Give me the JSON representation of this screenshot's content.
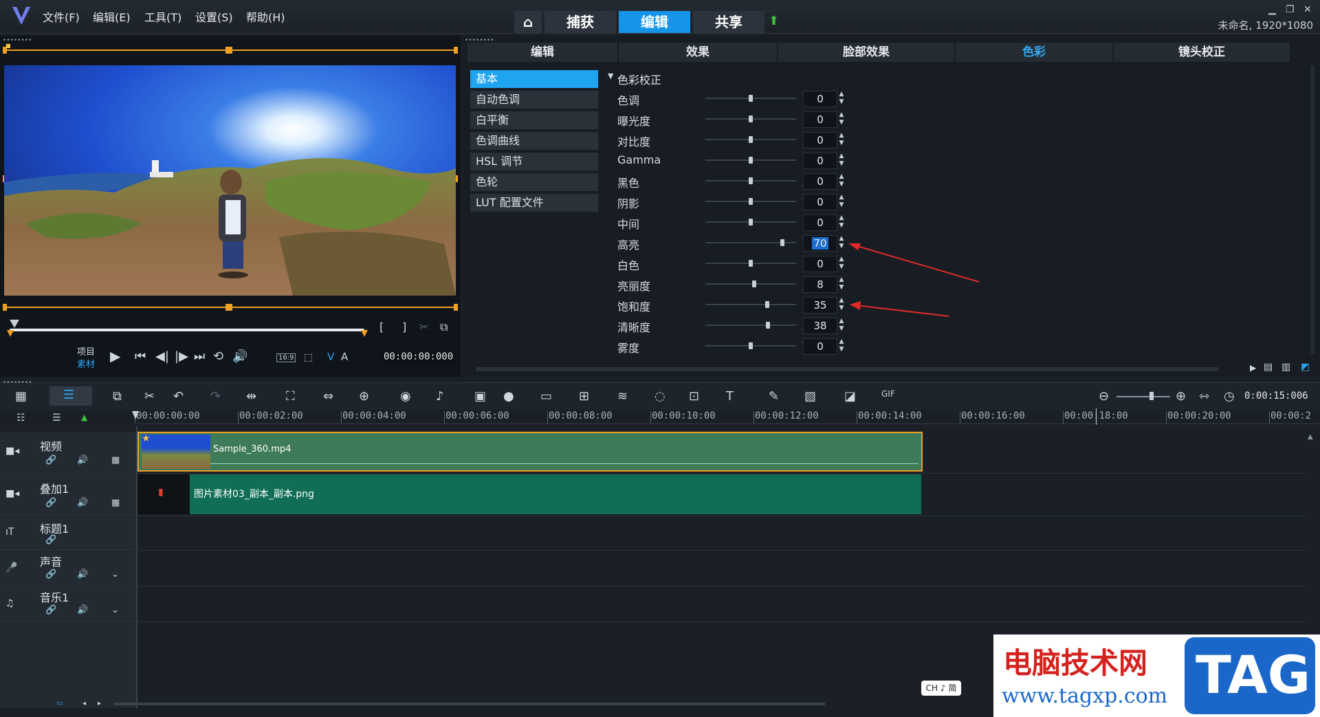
{
  "menu": [
    "文件(F)",
    "编辑(E)",
    "工具(T)",
    "设置(S)",
    "帮助(H)"
  ],
  "main_tabs": [
    "捕获",
    "编辑",
    "共享"
  ],
  "project_title": "未命名, 1920*1080",
  "preview": {
    "mode_project": "项目",
    "mode_clip": "素材",
    "aspect": "16:9",
    "timecode": "00:00:00:000",
    "v_label": "V",
    "a_label": "A"
  },
  "sub_tabs": [
    "编辑",
    "效果",
    "脸部效果",
    "色彩",
    "镜头校正"
  ],
  "categories": [
    "基本",
    "自动色调",
    "白平衡",
    "色调曲线",
    "HSL 调节",
    "色轮",
    "LUT 配置文件"
  ],
  "section_title": "色彩校正",
  "adjustments": [
    {
      "label": "色调",
      "value": "0",
      "pos": 0.5
    },
    {
      "label": "曝光度",
      "value": "0",
      "pos": 0.5
    },
    {
      "label": "对比度",
      "value": "0",
      "pos": 0.5
    },
    {
      "label": "Gamma",
      "value": "0",
      "pos": 0.5
    },
    {
      "label": "黑色",
      "value": "0",
      "pos": 0.5
    },
    {
      "label": "阴影",
      "value": "0",
      "pos": 0.5
    },
    {
      "label": "中间",
      "value": "0",
      "pos": 0.5
    },
    {
      "label": "高亮",
      "value": "70",
      "pos": 0.85
    },
    {
      "label": "白色",
      "value": "0",
      "pos": 0.5
    },
    {
      "label": "亮丽度",
      "value": "8",
      "pos": 0.54
    },
    {
      "label": "饱和度",
      "value": "35",
      "pos": 0.68
    },
    {
      "label": "清晰度",
      "value": "38",
      "pos": 0.69
    },
    {
      "label": "雾度",
      "value": "0",
      "pos": 0.5
    }
  ],
  "timeline": {
    "zoom_time": "0:00:15:006",
    "ruler": [
      "00:00:00:00",
      "00:00:02:00",
      "00:00:04:00",
      "00:00:06:00",
      "00:00:08:00",
      "00:00:10:00",
      "00:00:12:00",
      "00:00:14:00",
      "00:00:16:00",
      "00:00:18:00",
      "00:00:20:00",
      "00:00:2"
    ],
    "tracks": [
      "视频",
      "叠加1",
      "标题1",
      "声音",
      "音乐1"
    ],
    "clip_video": "Sample_360.mp4",
    "clip_overlay": "图片素材03_副本_副本.png"
  },
  "ime": "CH ♪ 简",
  "watermark": {
    "cn": "电脑技术网",
    "url": "www.tagxp.com",
    "tag": "TAG"
  }
}
